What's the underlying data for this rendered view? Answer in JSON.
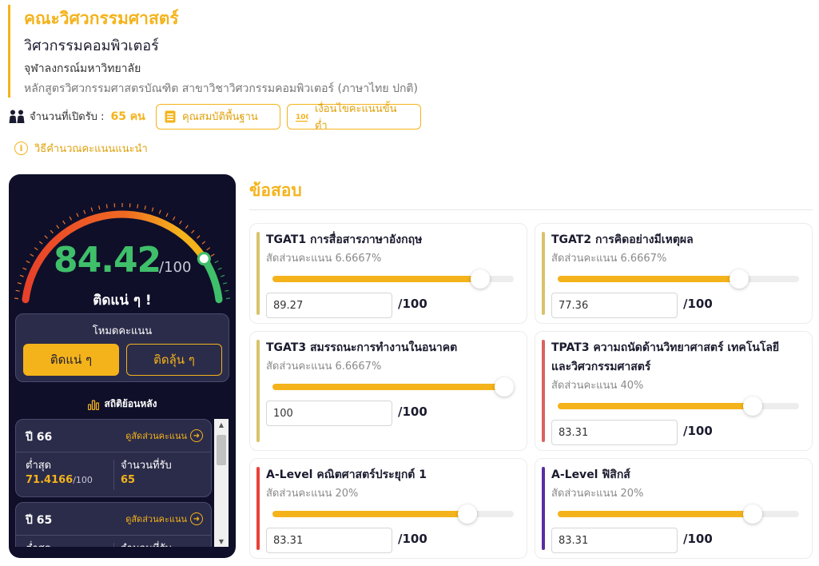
{
  "header": {
    "faculty": "คณะวิศวกรรมศาสตร์",
    "major": "วิศวกรรมคอมพิวเตอร์",
    "university": "จุฬาลงกรณ์มหาวิทยาลัย",
    "course": "หลักสูตรวิศวกรรมศาสตรบัณฑิต สาขาวิชาวิศวกรรมคอมพิวเตอร์ (ภาษาไทย ปกติ)"
  },
  "info": {
    "seats_label": "จำนวนที่เปิดรับ :",
    "seats_value": "65 คน",
    "qualifications_button": "คุณสมบัติพื้นฐาน",
    "min_score_button": "เงื่อนไขคะแนนขั้นต่ำ",
    "howto_link": "วิธีคำนวณคะแนนแนะนำ"
  },
  "panel": {
    "score": "84.42",
    "score_max": "/100",
    "gauge_fraction": 0.8442,
    "status": "ติดแน่ ๆ !",
    "mode_title": "โหมดคะแนน",
    "mode_active": "ติดแน่ ๆ",
    "mode_inactive": "ติดลุ้น ๆ",
    "history_title": "สถิติย้อนหลัง",
    "history": [
      {
        "year": "ปี 66",
        "link": "ดูสัดส่วนคะแนน",
        "min_label": "ต่ำสุด",
        "min_value": "71.4166",
        "min_max": "/100",
        "seats_label": "จำนวนที่รับ",
        "seats_value": "65"
      },
      {
        "year": "ปี 65",
        "link": "ดูสัดส่วนคะแนน",
        "min_label": "ต่ำสุด",
        "min_value": "",
        "min_max": "",
        "seats_label": "จำนวนที่รับ",
        "seats_value": ""
      }
    ]
  },
  "exams": {
    "title": "ข้อสอบ",
    "out_of": "/100",
    "items": [
      {
        "name": "TGAT1 การสื่อสารภาษาอังกฤษ",
        "ratio": "สัดส่วนคะแนน 6.6667%",
        "value": "89.27",
        "fraction": 0.8927,
        "color": "#d8c26a"
      },
      {
        "name": "TGAT2 การคิดอย่างมีเหตุผล",
        "ratio": "สัดส่วนคะแนน 6.6667%",
        "value": "77.36",
        "fraction": 0.7736,
        "color": "#d8c26a"
      },
      {
        "name": "TGAT3 สมรรถนะการทำงานในอนาคต",
        "ratio": "สัดส่วนคะแนน 6.6667%",
        "value": "100",
        "fraction": 1.0,
        "color": "#d8c26a"
      },
      {
        "name": "TPAT3 ความถนัดด้านวิทยาศาสตร์ เทคโนโลยี และวิศวกรรมศาสตร์",
        "ratio": "สัดส่วนคะแนน 40%",
        "value": "83.31",
        "fraction": 0.8331,
        "color": "#d9645f"
      },
      {
        "name": "A-Level คณิตศาสตร์ประยุกต์ 1",
        "ratio": "สัดส่วนคะแนน 20%",
        "value": "83.31",
        "fraction": 0.8331,
        "color": "#e8413a"
      },
      {
        "name": "A-Level ฟิสิกส์",
        "ratio": "สัดส่วนคะแนน 20%",
        "value": "83.31",
        "fraction": 0.8331,
        "color": "#5a2da0"
      }
    ]
  }
}
